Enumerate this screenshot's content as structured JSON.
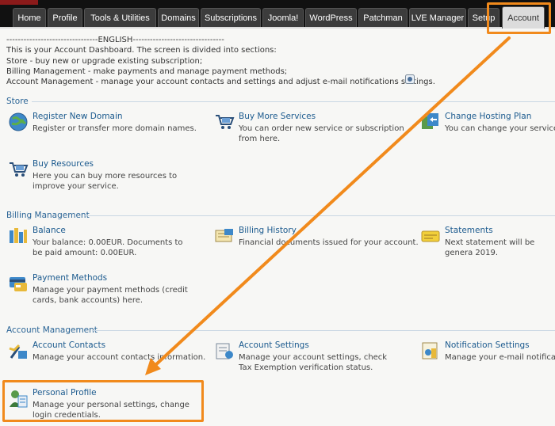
{
  "tabs": [
    "Home",
    "Profile",
    "Tools & Utilities",
    "Domains",
    "Subscriptions",
    "Joomla!",
    "WordPress",
    "Patchman",
    "LVE Manager",
    "Setup",
    "Account"
  ],
  "intro": {
    "divider": "--------------------------------ENGLISH--------------------------------",
    "line1": "This is your Account Dashboard. The screen is divided into sections:",
    "line2": "Store - buy new or upgrade existing subscription;",
    "line3": "Billing Management - make payments and manage payment methods;",
    "line4": "Account Management - manage your account contacts and settings and adjust e-mail notifications settings."
  },
  "sections": {
    "store": {
      "title": "Store",
      "items": [
        {
          "title": "Register New Domain",
          "desc": "Register or transfer more domain names."
        },
        {
          "title": "Buy More Services",
          "desc": "You can order new service or subscription from here."
        },
        {
          "title": "Change Hosting Plan",
          "desc": "You can change your service pl"
        },
        {
          "title": "Buy Resources",
          "desc": "Here you can buy more resources to improve your service."
        }
      ]
    },
    "billing": {
      "title": "Billing Management",
      "items": [
        {
          "title": "Balance",
          "desc": "Your balance: 0.00EUR. Documents to be paid amount: 0.00EUR."
        },
        {
          "title": "Billing History",
          "desc": "Financial documents issued for your account."
        },
        {
          "title": "Statements",
          "desc": "Next statement will be genera 2019."
        },
        {
          "title": "Payment Methods",
          "desc": "Manage your payment methods (credit cards, bank accounts) here."
        }
      ]
    },
    "account": {
      "title": "Account Management",
      "items": [
        {
          "title": "Account Contacts",
          "desc": "Manage your account contacts information."
        },
        {
          "title": "Account Settings",
          "desc": "Manage your account settings, check Tax Exemption verification status."
        },
        {
          "title": "Notification Settings",
          "desc": "Manage your e-mail notification"
        },
        {
          "title": "Personal Profile",
          "desc": "Manage your personal settings, change login credentials."
        }
      ]
    }
  },
  "colors": {
    "accent_orange": "#f18a1c",
    "link_blue": "#1b5a8e",
    "section_blue": "#2a6496",
    "nav_bg": "#111111"
  }
}
